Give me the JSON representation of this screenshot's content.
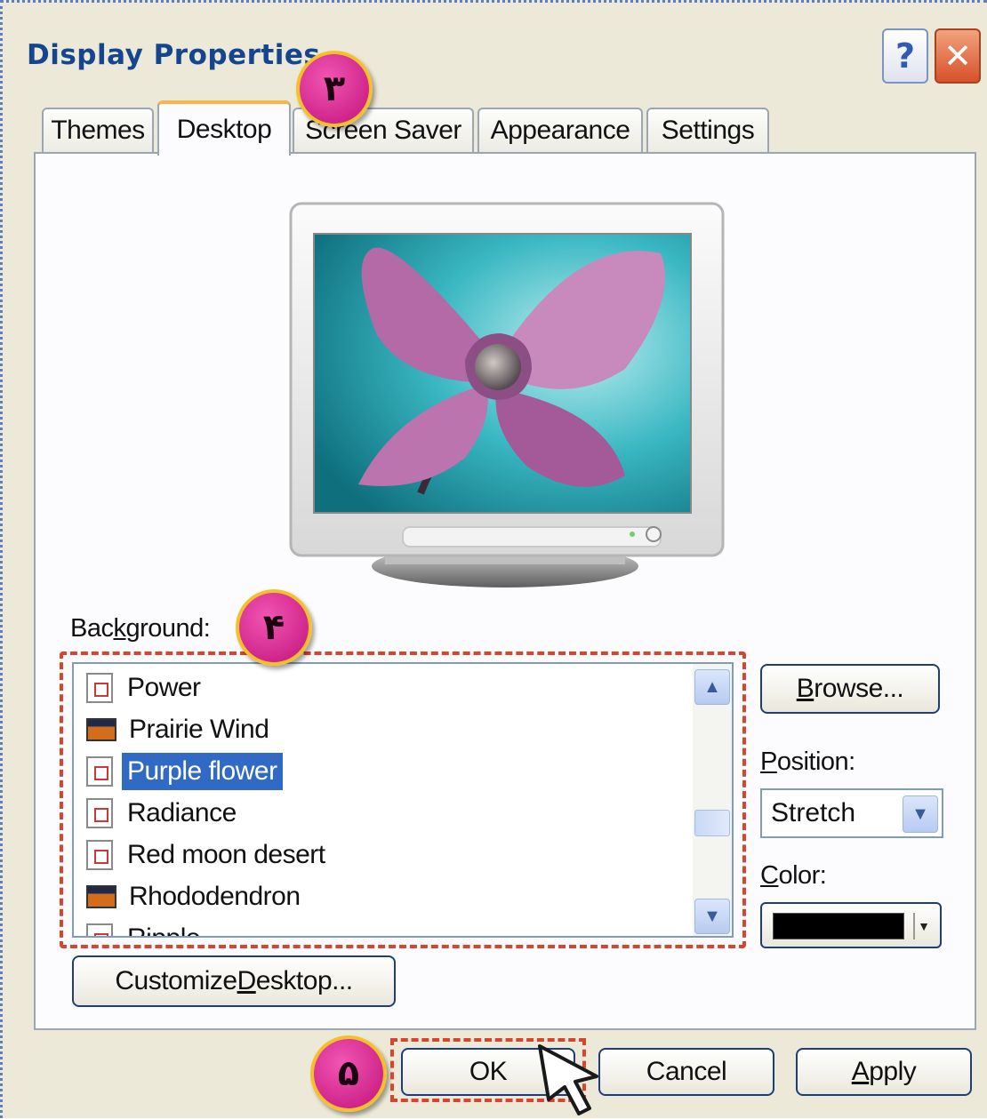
{
  "window": {
    "title": "Display Properties",
    "help_glyph": "?",
    "close_glyph": "✕"
  },
  "tabs": [
    {
      "label": "Themes",
      "active": false
    },
    {
      "label": "Desktop",
      "active": true
    },
    {
      "label": "Screen Saver",
      "active": false
    },
    {
      "label": "Appearance",
      "active": false
    },
    {
      "label": "Settings",
      "active": false
    }
  ],
  "badges": {
    "step3": "٣",
    "step4": "۴",
    "step5": "۵"
  },
  "background": {
    "label_pre": "Bac",
    "label_ul": "k",
    "label_post": "ground:",
    "items": [
      {
        "label": "Power",
        "icon": "file-icon"
      },
      {
        "label": "Prairie Wind",
        "icon": "image-icon"
      },
      {
        "label": "Purple flower",
        "icon": "file-icon",
        "selected": true
      },
      {
        "label": "Radiance",
        "icon": "file-icon"
      },
      {
        "label": "Red moon desert",
        "icon": "file-icon"
      },
      {
        "label": "Rhododendron",
        "icon": "image-icon"
      },
      {
        "label": "Ripple",
        "icon": "file-icon"
      }
    ]
  },
  "side": {
    "browse_ul": "B",
    "browse_rest": "rowse...",
    "position_ul": "P",
    "position_rest": "osition:",
    "position_value": "Stretch",
    "color_ul": "C",
    "color_rest": "olor:",
    "color_value": "#000000"
  },
  "customize": {
    "pre": "Customize ",
    "ul": "D",
    "post": "esktop..."
  },
  "footer": {
    "ok": "OK",
    "cancel": "Cancel",
    "apply_ul": "A",
    "apply_rest": "pply"
  },
  "colors": {
    "title": "#16458f",
    "selection": "#316ac5",
    "badge": "#e0319a",
    "dashed_highlight": "#d9452c"
  }
}
